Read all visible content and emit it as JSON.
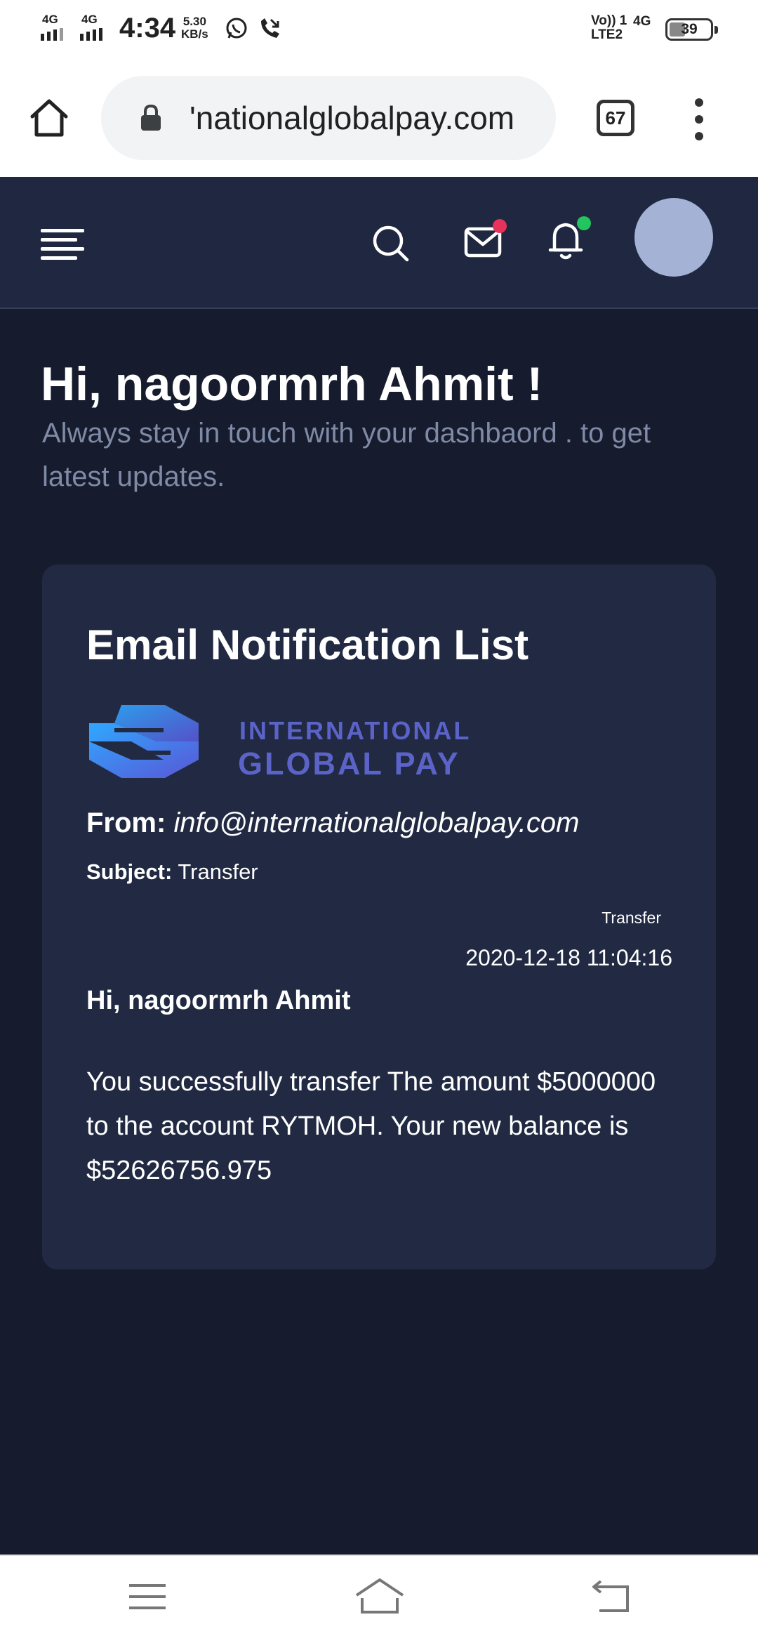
{
  "status_bar": {
    "network_1": "4G",
    "network_2": "4G",
    "time": "4:34",
    "speed_value": "5.30",
    "speed_unit": "KB/s",
    "volte_line1": "Vo)) 1",
    "volte_line2": "LTE2",
    "network_right": "4G",
    "battery": "39",
    "icons": [
      "whatsapp-icon",
      "missed-call-icon"
    ]
  },
  "browser": {
    "url": "'nationalglobalpay.com",
    "tab_count": "67",
    "icons": [
      "home-icon",
      "lock-icon",
      "more-vert-icon"
    ]
  },
  "app_header": {
    "icons": [
      "hamburger-icon",
      "search-icon",
      "mail-icon",
      "bell-icon"
    ],
    "mail_badge_color": "#e8315b",
    "bell_badge_color": "#22c55e",
    "avatar_color": "#a4b2d6"
  },
  "main": {
    "greeting": "Hi, nagoormrh Ahmit !",
    "subtitle": "Always stay in touch with your dashbaord . to get latest updates."
  },
  "card": {
    "title": "Email Notification List",
    "logo_line1": "INTERNATIONAL",
    "logo_line2": "GLOBAL PAY",
    "from_label": "From:",
    "from_value": "info@internationalglobalpay.com",
    "subject_label": "Subject:",
    "subject_value": "Transfer",
    "type_label": "Transfer",
    "datetime": "2020-12-18 11:04:16",
    "message_greeting": "Hi, nagoormrh Ahmit",
    "message_body": "You successfully transfer The amount $5000000 to the account RYTMOH. Your new balance is $52626756.975"
  },
  "nav_bar": {
    "icons": [
      "recent-apps-icon",
      "home-icon",
      "back-icon"
    ]
  }
}
